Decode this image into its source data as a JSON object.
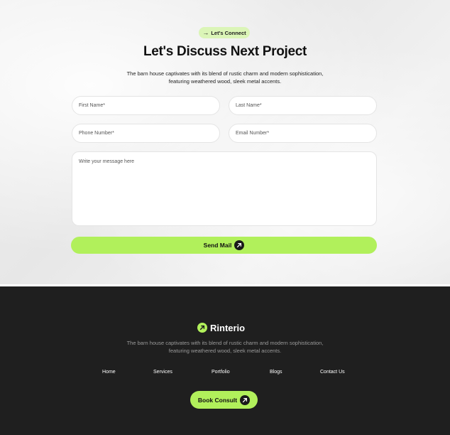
{
  "contact": {
    "tag_label": "Let's Connect",
    "headline": "Let's Discuss Next Project",
    "subtitle_line1": "The barn house captivates with its blend of rustic charm and modern sophistication,",
    "subtitle_line2": "featuring weathered wood, sleek metal accents.",
    "form": {
      "first_name_placeholder": "First Name*",
      "last_name_placeholder": "Last Name*",
      "phone_placeholder": "Phone Number*",
      "email_placeholder": "Email Number*",
      "message_placeholder": "Write your message here"
    },
    "send_label": "Send Mail"
  },
  "footer": {
    "brand": "Rinterio",
    "subtitle_line1": "The barn house captivates with its blend of rustic charm and modern sophistication,",
    "subtitle_line2": "featuring weathered wood, sleek metal accents.",
    "nav": [
      "Home",
      "Services",
      "Portfolio",
      "Blogs",
      "Contact Us"
    ],
    "cta_label": "Book Consult"
  },
  "colors": {
    "accent": "#b1f05b",
    "accent_soft": "#dbf5b7",
    "footer_bg": "#1f1f1f"
  },
  "icons": {
    "tag": "arrow-right-icon",
    "button": "arrow-up-right-icon",
    "brand": "arrow-up-right-icon"
  }
}
